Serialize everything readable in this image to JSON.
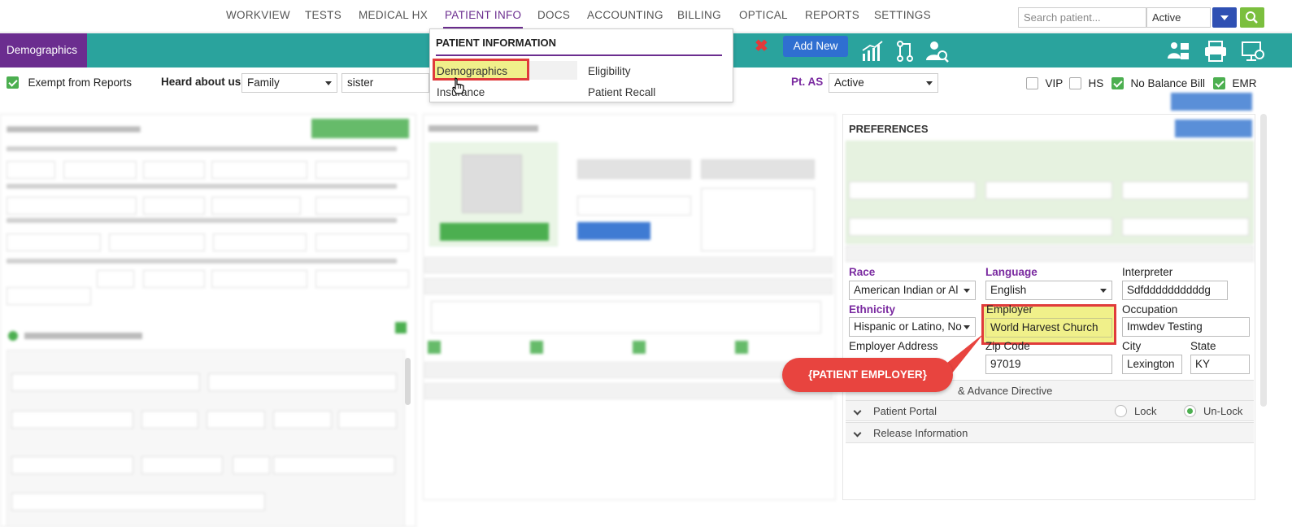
{
  "nav": {
    "items": [
      "WORKVIEW",
      "TESTS",
      "MEDICAL HX",
      "PATIENT INFO",
      "DOCS",
      "ACCOUNTING",
      "BILLING",
      "OPTICAL",
      "REPORTS",
      "SETTINGS"
    ],
    "active": "PATIENT INFO",
    "search_placeholder": "Search patient...",
    "status_value": "Active"
  },
  "toolbar": {
    "tab_label": "Demographics",
    "add_new_label": "Add New"
  },
  "menu": {
    "title": "PATIENT INFORMATION",
    "items": [
      "Demographics",
      "Eligibility",
      "Insurance",
      "Patient Recall"
    ],
    "highlighted": "Demographics"
  },
  "row2": {
    "exempt_label": "Exempt from Reports",
    "heard_label": "Heard about us",
    "heard_value": "Family",
    "heard_detail": "sister",
    "pt_as_label": "Pt. AS",
    "pt_as_value": "Active",
    "flags": [
      {
        "label": "VIP",
        "checked": false
      },
      {
        "label": "HS",
        "checked": false
      },
      {
        "label": "No Balance Bill",
        "checked": true
      },
      {
        "label": "EMR",
        "checked": true
      }
    ]
  },
  "preferences": {
    "title": "PREFERENCES",
    "race_label": "Race",
    "race_value": "American Indian or Al",
    "language_label": "Language",
    "language_value": "English",
    "interpreter_label": "Interpreter",
    "interpreter_value": "Sdfddddddddddg",
    "ethnicity_label": "Ethnicity",
    "ethnicity_value": "Hispanic or Latino, No",
    "employer_label": "Employer",
    "employer_value": "World Harvest Church",
    "occupation_label": "Occupation",
    "occupation_value": "Imwdev Testing",
    "employer_address_label": "Employer Address",
    "zip_label": "Zip Code",
    "zip_value": "97019",
    "city_label": "City",
    "city_value": "Lexington",
    "state_label": "State",
    "state_value": "KY",
    "advance_directive": "& Advance Directive",
    "portal_label": "Patient Portal",
    "lock_label": "Lock",
    "unlock_label": "Un-Lock",
    "portal_state": "Un-Lock",
    "release_label": "Release Information"
  },
  "callout": {
    "text": "{PATIENT EMPLOYER}",
    "color": "#e8443f"
  },
  "colors": {
    "purple": "#6b2d8f",
    "teal": "#2aa39d",
    "blue": "#2f6fd1",
    "green": "#4caf50",
    "highlight": "#f0f08a",
    "red": "#e03b3b"
  }
}
